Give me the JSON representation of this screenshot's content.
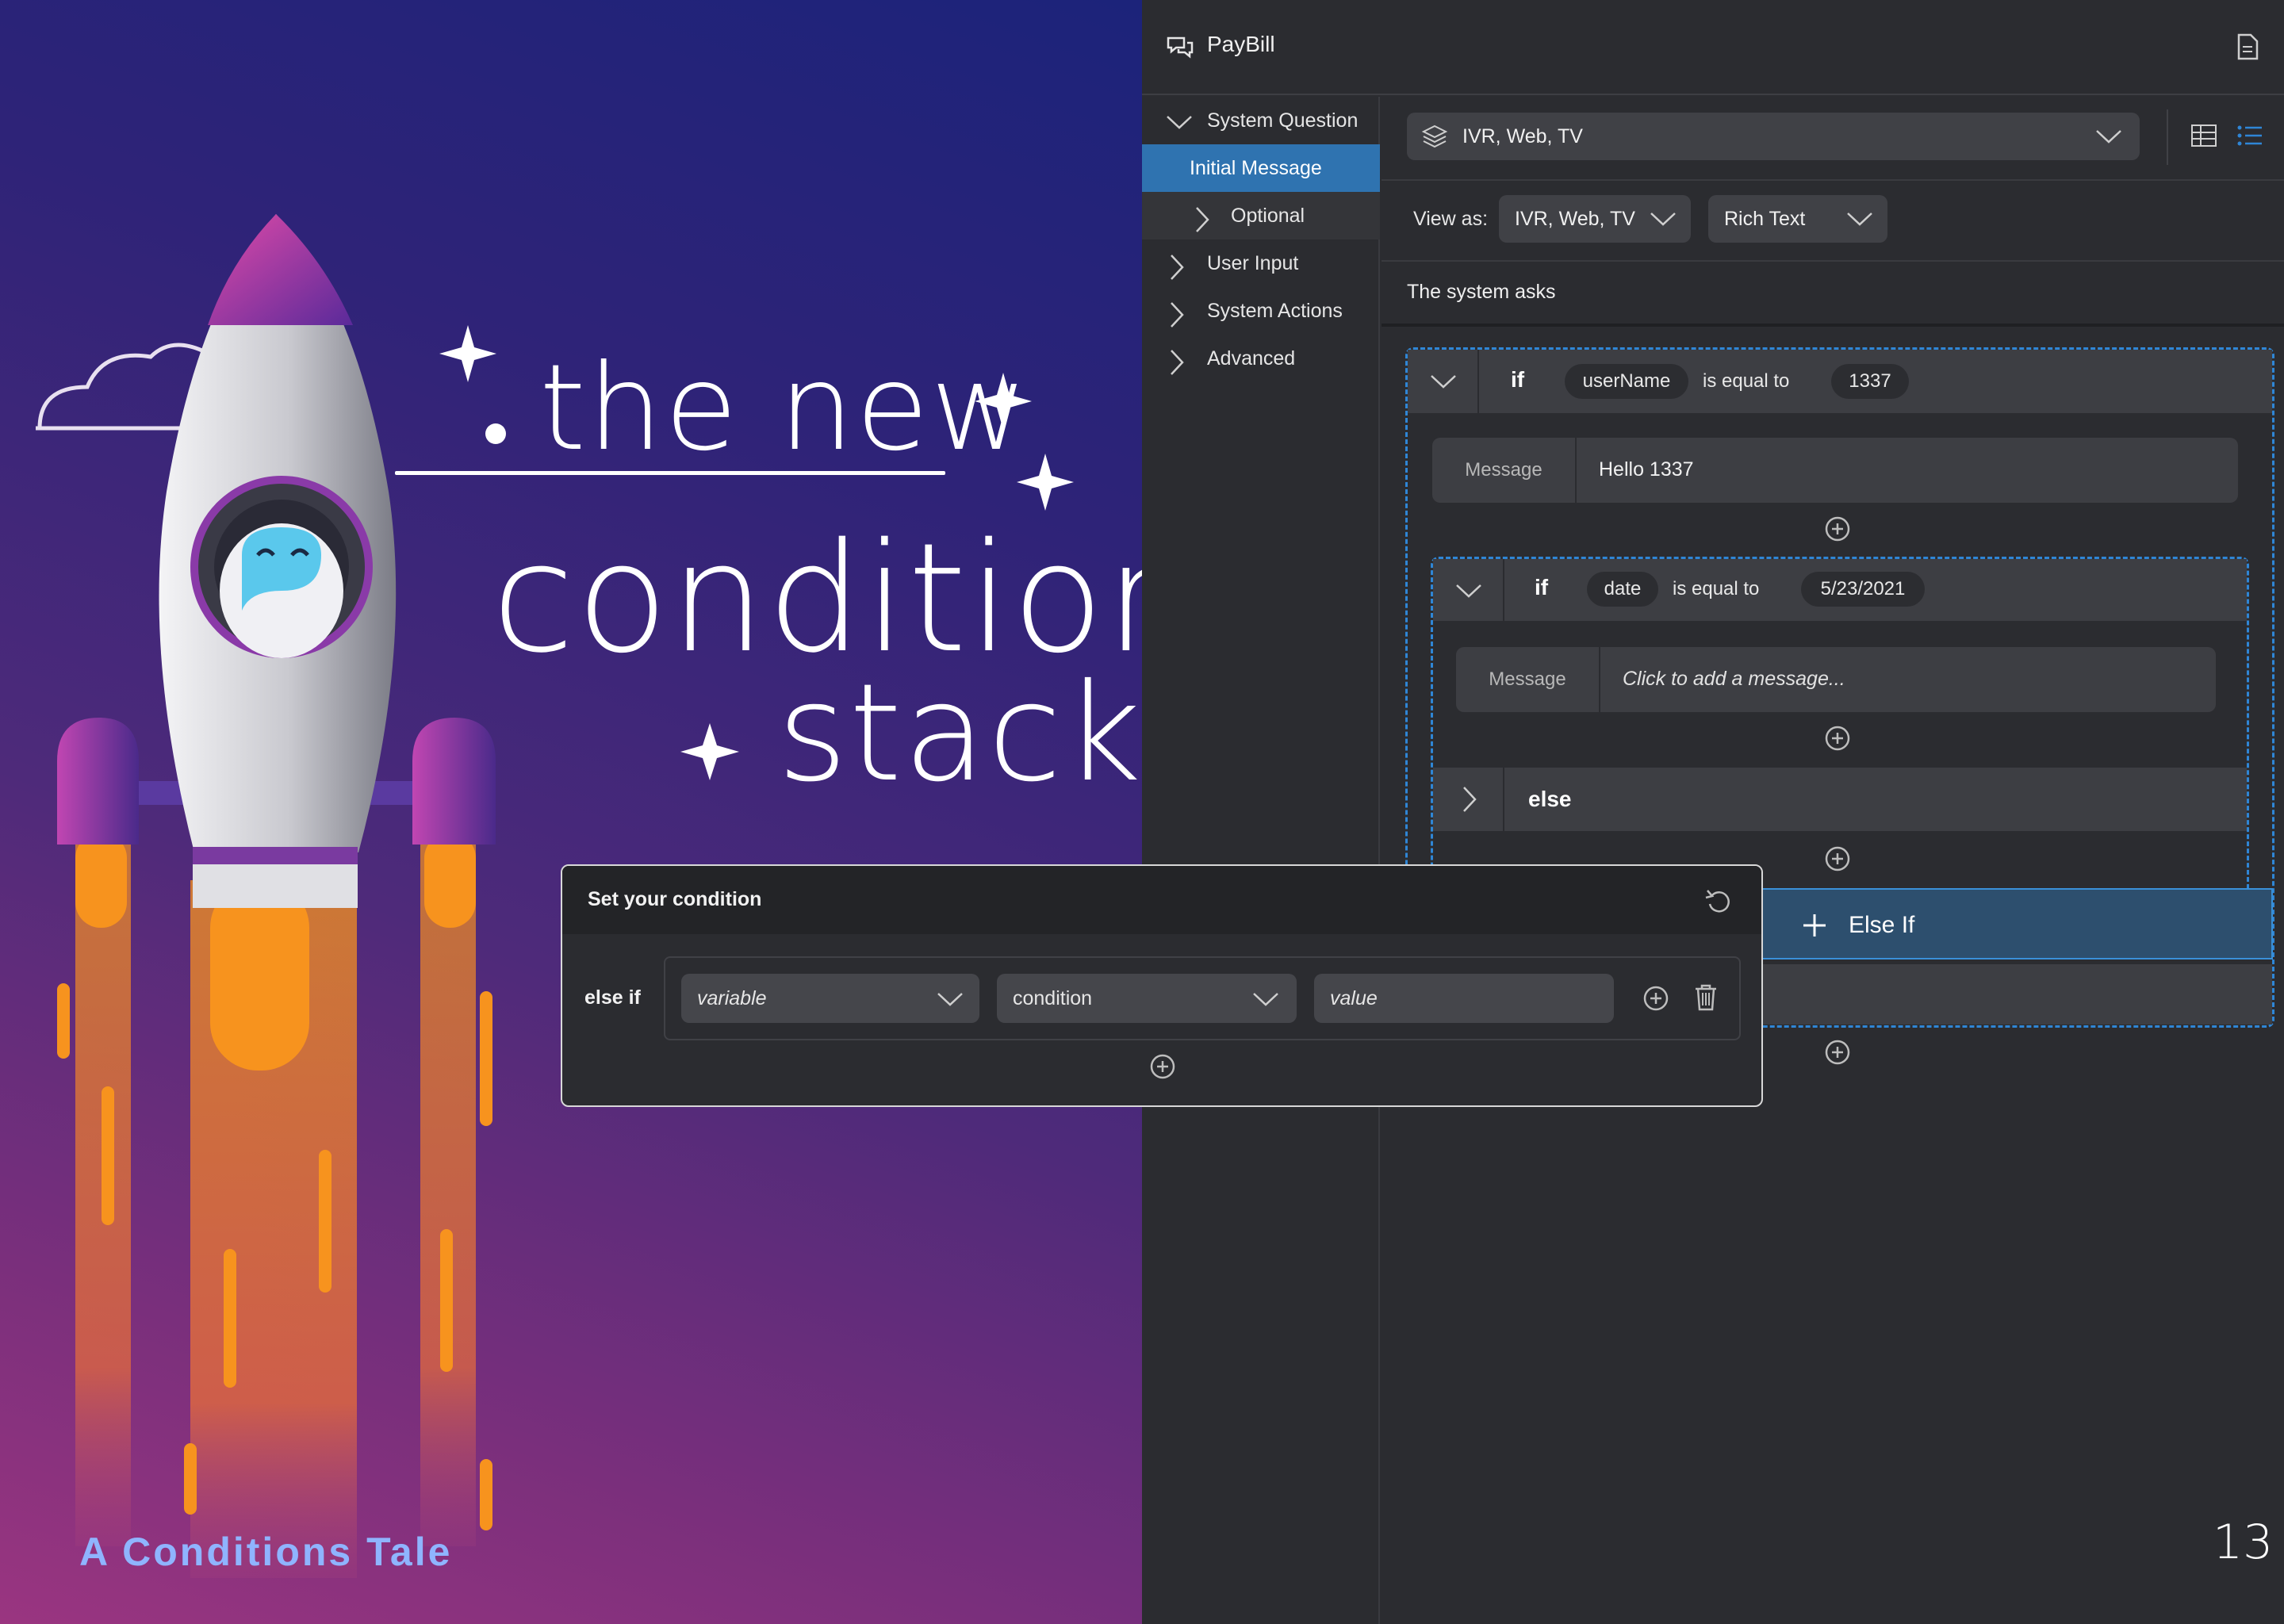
{
  "hero": {
    "line1": "the new",
    "line2": "condition",
    "line3": "stack",
    "tale_title": "A Conditions Tale"
  },
  "app": {
    "title": "PayBill",
    "page_number": "13"
  },
  "sidebar": {
    "items": [
      {
        "label": "System Question",
        "expanded": true
      },
      {
        "label": "Initial Message",
        "selected": true
      },
      {
        "label": "Optional"
      },
      {
        "label": "User Input"
      },
      {
        "label": "System Actions"
      },
      {
        "label": "Advanced"
      }
    ]
  },
  "toolbar": {
    "channel_select": "IVR, Web, TV",
    "view_as_label": "View as:",
    "view_as_channel": "IVR, Web, TV",
    "view_as_format": "Rich Text"
  },
  "section": {
    "heading": "The system asks"
  },
  "conditions": {
    "if1": {
      "keyword": "if",
      "variable": "userName",
      "operator": "is equal to",
      "value": "1337",
      "message_label": "Message",
      "message_text": "Hello 1337"
    },
    "if2": {
      "keyword": "if",
      "variable": "date",
      "operator": "is equal to",
      "value": "5/23/2021",
      "message_label": "Message",
      "message_placeholder": "Click to add a message..."
    },
    "else_label": "else",
    "else_if_label": "Else If"
  },
  "dialog": {
    "title": "Set your condition",
    "row_label": "else if",
    "variable_placeholder": "variable",
    "condition_value": "condition",
    "value_placeholder": "value"
  },
  "colors": {
    "accent": "#2f86d6",
    "selected": "#2f73b0",
    "panel": "#2b2c30",
    "bar": "#3d3e43",
    "flame": "#f7931e",
    "tale_title": "#8fb4ff"
  }
}
